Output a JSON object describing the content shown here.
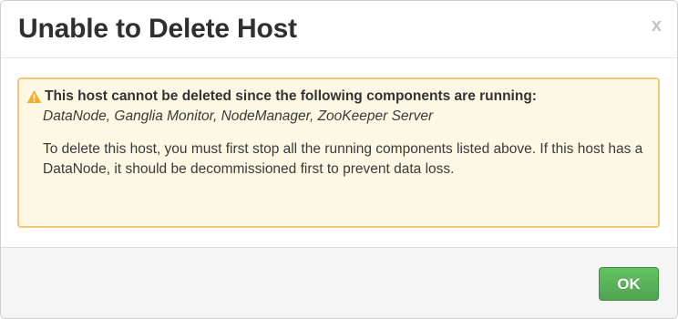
{
  "dialog": {
    "title": "Unable to Delete Host",
    "close_label": "x"
  },
  "alert": {
    "icon": "warning-icon",
    "heading": "This host cannot be deleted since the following components are running:",
    "components": "DataNode, Ganglia Monitor, NodeManager, ZooKeeper Server",
    "instructions": "To delete this host, you must first stop all the running components listed above. If this host has a DataNode, it should be decommissioned first to prevent data loss."
  },
  "footer": {
    "ok_label": "OK"
  },
  "colors": {
    "alert_background": "#fcf8e3",
    "alert_border": "#f2c779",
    "warning_icon": "#f0ad2e",
    "ok_button": "#51a351"
  }
}
